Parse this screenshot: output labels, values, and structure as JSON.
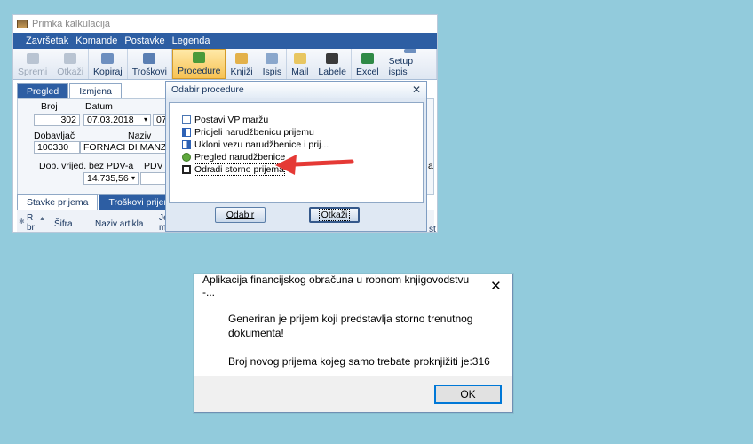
{
  "app": {
    "title": "Primka kalkulacija",
    "menu": [
      "Završetak",
      "Komande",
      "Postavke",
      "Legenda"
    ],
    "toolbar": [
      {
        "label": "Spremi",
        "icon": "save-icon",
        "state": "disabled"
      },
      {
        "label": "Otkaži",
        "icon": "undo-icon",
        "state": "disabled"
      },
      {
        "label": "Kopiraj",
        "icon": "copy-icon",
        "state": "normal"
      },
      {
        "label": "Troškovi",
        "icon": "costs-icon",
        "state": "normal"
      },
      {
        "label": "Procedure",
        "icon": "procedure-icon",
        "state": "active"
      },
      {
        "label": "Knjiži",
        "icon": "book-icon",
        "state": "normal"
      },
      {
        "label": "Ispis",
        "icon": "print-icon",
        "state": "normal"
      },
      {
        "label": "Mail",
        "icon": "mail-icon",
        "state": "normal"
      },
      {
        "label": "Labele",
        "icon": "labels-icon",
        "state": "normal"
      },
      {
        "label": "Excel",
        "icon": "excel-icon",
        "state": "normal"
      },
      {
        "label": "Setup ispis",
        "icon": "print-setup-icon",
        "state": "normal"
      }
    ],
    "tabs": [
      "Pregled",
      "Izmjena"
    ],
    "form": {
      "broj_label": "Broj",
      "broj_value": "302",
      "datum_label": "Datum",
      "datum_value": "07.03.2018",
      "datum2_value": "07.0",
      "dobavljac_label": "Dobavljač",
      "dobavljac_value": "100330",
      "naziv_label": "Naziv",
      "naziv_value": "FORNACI DI MANZANO S.P",
      "dob_vrijed_label": "Dob. vrijed. bez PDV-a",
      "dob_vrijed_value": "14.735,56",
      "pdv_label": "PDV d",
      "right_label_a": "a"
    },
    "bottom_tabs": [
      "Stavke prijema",
      "Troškovi prijema"
    ],
    "grid_headers": [
      "R br",
      "Šifra",
      "Naziv artikla",
      "Je mj"
    ],
    "grid_right_header": "st"
  },
  "procedure_dialog": {
    "title": "Odabir procedure",
    "items": [
      {
        "label": "Postavi VP maržu",
        "icon": "document-icon"
      },
      {
        "label": "Pridjeli narudžbenicu prijemu",
        "icon": "link-icon"
      },
      {
        "label": "Ukloni vezu narudžbenice i prij...",
        "icon": "unlink-icon"
      },
      {
        "label": "Pregled narudžbenice",
        "icon": "pencil-icon"
      },
      {
        "label": "Odradi storno prijema",
        "icon": "storno-icon"
      }
    ],
    "ok_label": "Odabir",
    "cancel_label": "Otkaži"
  },
  "message_box": {
    "title": "Aplikacija financijskog obračuna u robnom knjigovodstvu -...",
    "line1": "Generiran je prijem koji predstavlja storno trenutnog",
    "line2": "dokumenta!",
    "line3": "Broj novog prijema kojeg samo trebate proknjižiti je:316",
    "ok_label": "OK"
  },
  "colors": {
    "desktop": "#92cbdc",
    "menubar": "#2d5ea3",
    "arrow": "#e53935",
    "ok_border": "#0078d7"
  }
}
